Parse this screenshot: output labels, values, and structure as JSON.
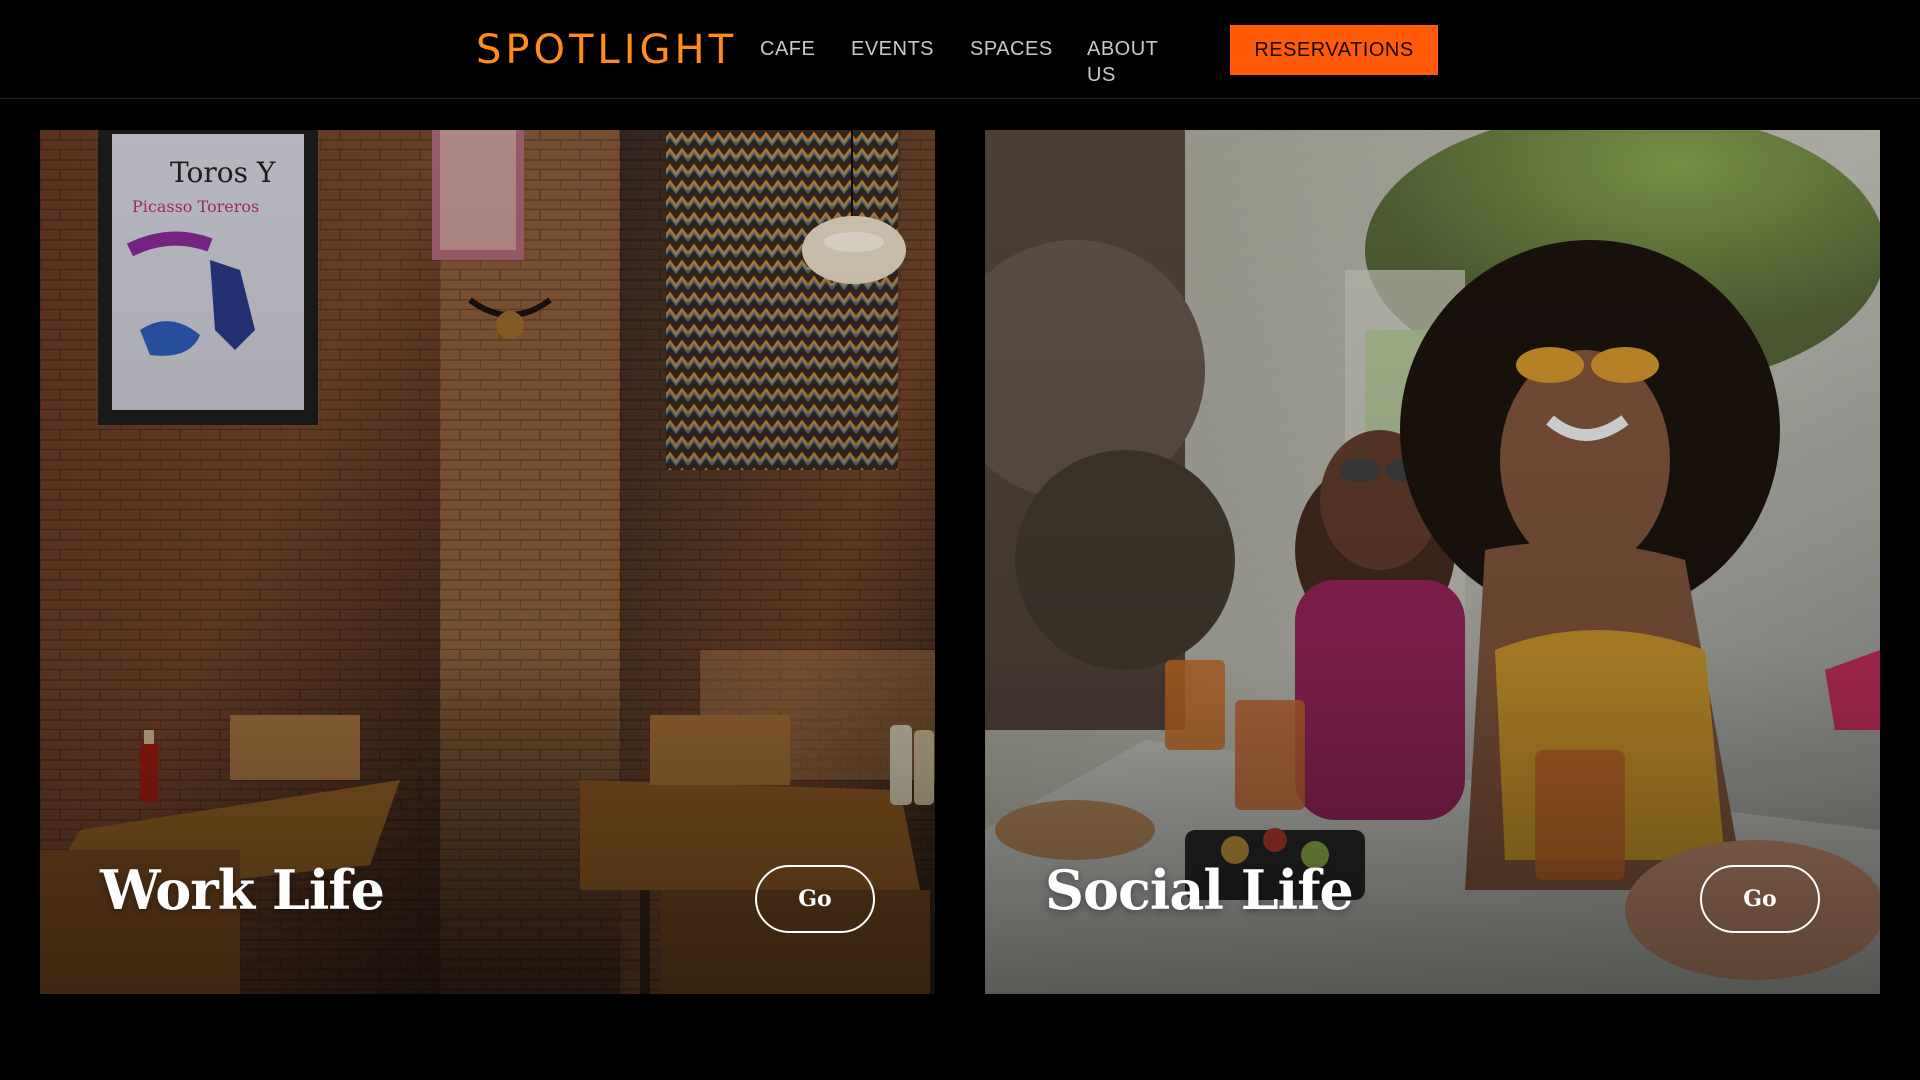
{
  "header": {
    "logo_text": "SPOTLIGHT",
    "nav": [
      "CAFE",
      "EVENTS",
      "SPACES",
      "ABOUT US"
    ],
    "reservations_label": "RESERVATIONS"
  },
  "cards": [
    {
      "title": "Work Life",
      "button_label": "Go",
      "image": "cafe-interior-brick-wall"
    },
    {
      "title": "Social Life",
      "button_label": "Go",
      "image": "friends-laughing-at-outdoor-table"
    }
  ],
  "colors": {
    "background": "#000000",
    "logo": "#ff8c1a",
    "accent": "#ff5a0a",
    "nav_text": "#c9c9c9"
  }
}
